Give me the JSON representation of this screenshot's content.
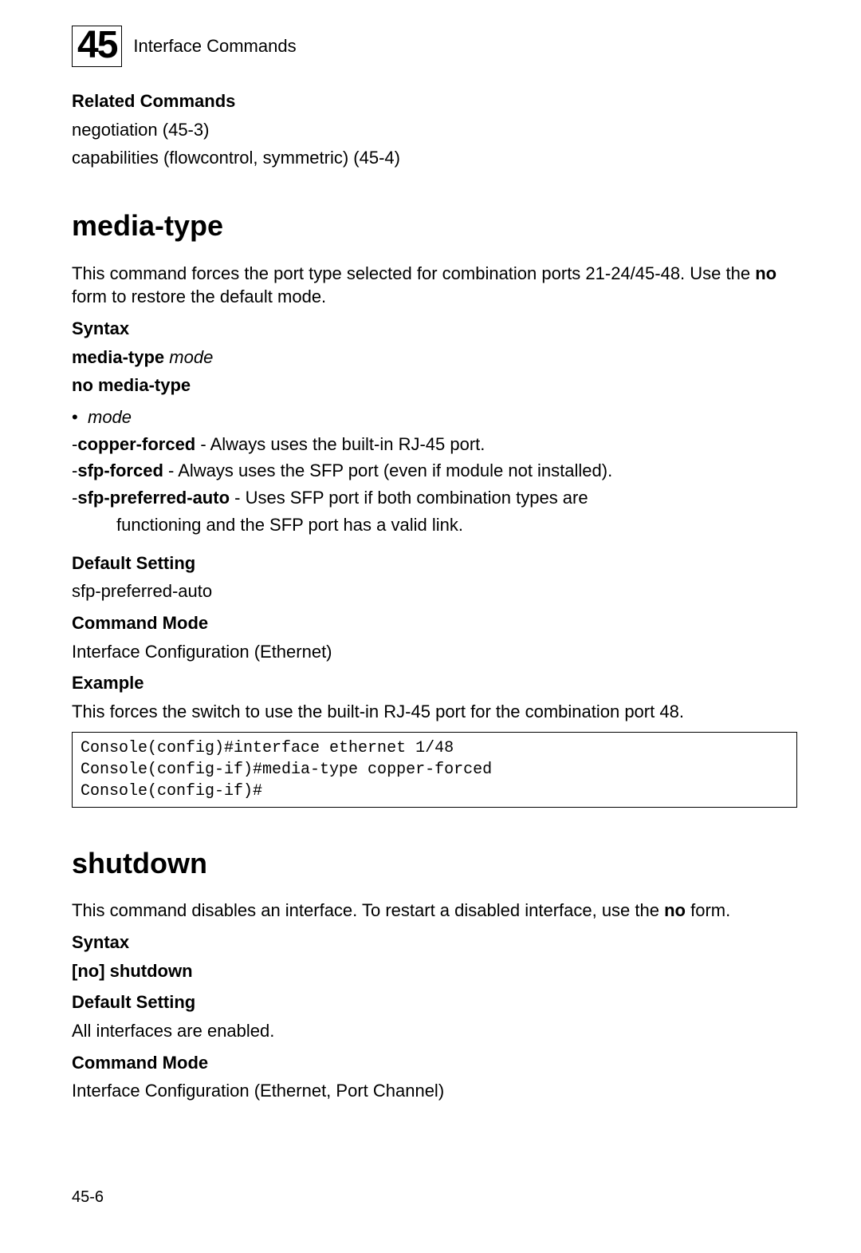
{
  "header": {
    "chapter_number": "45",
    "chapter_name": "Interface Commands"
  },
  "related": {
    "heading": "Related Commands",
    "lines": [
      "negotiation (45-3)",
      "capabilities (flowcontrol, symmetric) (45-4)"
    ]
  },
  "media_type": {
    "title": "media-type",
    "desc_pre": "This command forces the port type selected for combination ports 21-24/45-48. Use the ",
    "desc_bold": "no",
    "desc_post": " form to restore the default mode.",
    "syntax_heading": "Syntax",
    "syntax_line1_bold": "media-type",
    "syntax_line1_ital": " mode",
    "syntax_line2_bold": "no media-type",
    "mode_word": "mode",
    "opts": {
      "a_bold": "copper-forced",
      "a_rest": " - Always uses the built-in RJ-45 port.",
      "b_bold": "sfp-forced",
      "b_rest": " - Always uses the SFP port (even if module not installed).",
      "c_bold": "sfp-preferred-auto",
      "c_rest": " - Uses SFP port if both combination types are",
      "c_cont": "functioning and the SFP port has a valid link."
    },
    "default_heading": "Default Setting",
    "default_value": "sfp-preferred-auto",
    "mode_heading": "Command Mode",
    "mode_value": "Interface Configuration (Ethernet)",
    "example_heading": "Example",
    "example_desc": "This forces the switch to use the built-in RJ-45 port for the combination port 48.",
    "example_code": "Console(config)#interface ethernet 1/48\nConsole(config-if)#media-type copper-forced\nConsole(config-if)#"
  },
  "shutdown": {
    "title": "shutdown",
    "desc_pre": "This command disables an interface. To restart a disabled interface, use the ",
    "desc_bold": "no",
    "desc_post": " form.",
    "syntax_heading": "Syntax",
    "syntax_open": "[",
    "syntax_no": "no",
    "syntax_close": "]",
    "syntax_cmd": " shutdown",
    "default_heading": "Default Setting",
    "default_value": "All interfaces are enabled.",
    "mode_heading": "Command Mode",
    "mode_value": "Interface Configuration (Ethernet, Port Channel)"
  },
  "page_number": "45-6"
}
